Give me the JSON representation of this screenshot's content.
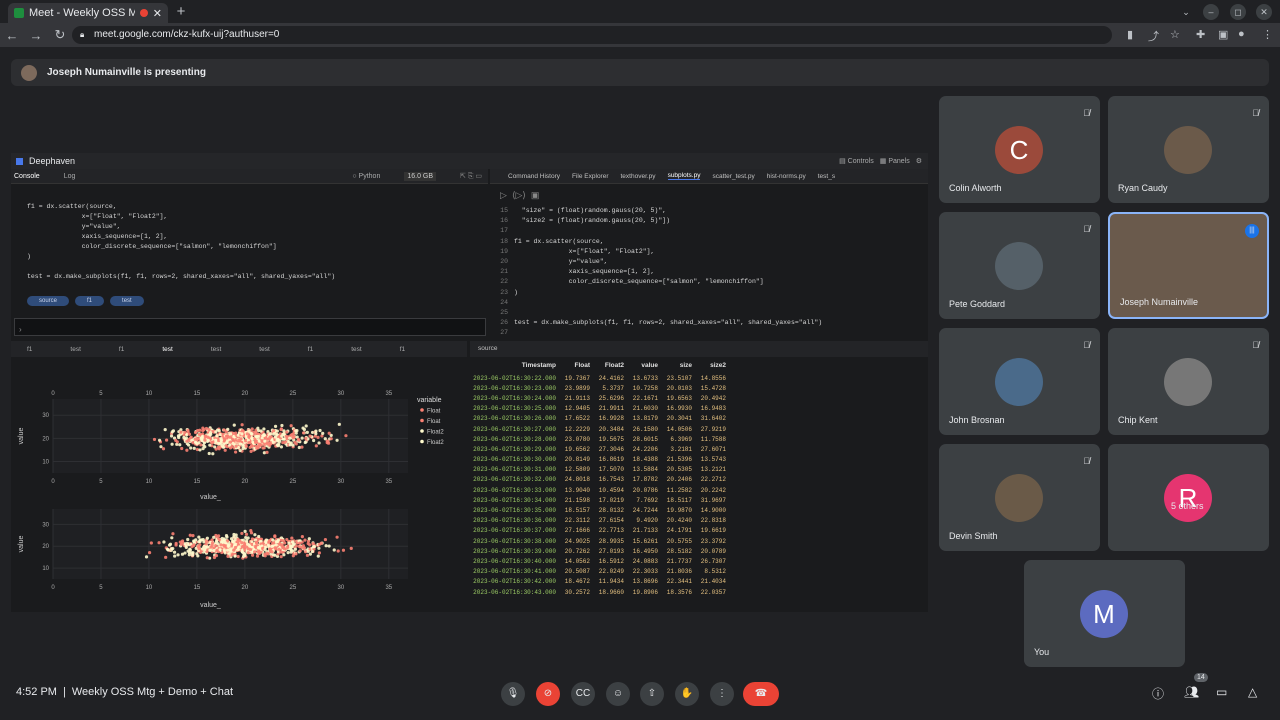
{
  "browser": {
    "tab_title": "Meet - Weekly OSS Mtg",
    "url": "meet.google.com/ckz-kufx-uij?authuser=0"
  },
  "banner": {
    "text": "Joseph Numainville is presenting"
  },
  "deephaven": {
    "title": "Deephaven",
    "controls_label": "Controls",
    "panels_label": "Panels",
    "console_tab": "Console",
    "log_tab": "Log",
    "lang": "Python",
    "mem": "16.0 GB",
    "console_code": "f1 = dx.scatter(source,\n              x=[\"Float\", \"Float2\"],\n              y=\"value\",\n              xaxis_sequence=[1, 2],\n              color_discrete_sequence=[\"salmon\", \"lemonchiffon\"]\n)\n\ntest = dx.make_subplots(f1, f1, rows=2, shared_xaxes=\"all\", shared_yaxes=\"all\")",
    "console_pills": [
      "source",
      "f1",
      "test"
    ],
    "editor_tabs": [
      "Command History",
      "File Explorer",
      "texthover.py",
      "subplots.py",
      "scatter_test.py",
      "hist-norms.py",
      "test_s"
    ],
    "editor_active_tab": "subplots.py",
    "editor_lines": [
      {
        "n": "15",
        "code": "  \"size\" = (float)random.gauss(20, 5)\","
      },
      {
        "n": "16",
        "code": "  \"size2 = (float)random.gauss(20, 5)\"])"
      },
      {
        "n": "17",
        "code": ""
      },
      {
        "n": "18",
        "code": "f1 = dx.scatter(source,"
      },
      {
        "n": "19",
        "code": "              x=[\"Float\", \"Float2\"],"
      },
      {
        "n": "20",
        "code": "              y=\"value\","
      },
      {
        "n": "21",
        "code": "              xaxis_sequence=[1, 2],"
      },
      {
        "n": "22",
        "code": "              color_discrete_sequence=[\"salmon\", \"lemonchiffon\"]"
      },
      {
        "n": "23",
        "code": ")"
      },
      {
        "n": "24",
        "code": ""
      },
      {
        "n": "25",
        "code": ""
      },
      {
        "n": "26",
        "code": "test = dx.make_subplots(f1, f1, rows=2, shared_xaxes=\"all\", shared_yaxes=\"all\")"
      },
      {
        "n": "27",
        "code": ""
      }
    ],
    "plot_tabs": [
      "f1",
      "test",
      "f1",
      "test",
      "test",
      "test",
      "f1",
      "test",
      "f1"
    ],
    "plot_active": "test",
    "table_tab": "source",
    "table_columns": [
      "Timestamp",
      "Float",
      "Float2",
      "value",
      "size",
      "size2"
    ],
    "table_rows": [
      [
        "2023-06-02T16:30:22.000",
        "19.7367",
        "24.4162",
        "13.6733",
        "23.5107",
        "14.8556"
      ],
      [
        "2023-06-02T16:30:23.000",
        "23.9899",
        "5.3737",
        "10.7258",
        "20.0103",
        "15.4728"
      ],
      [
        "2023-06-02T16:30:24.000",
        "21.9113",
        "25.6296",
        "22.1671",
        "19.6563",
        "20.4942"
      ],
      [
        "2023-06-02T16:30:25.000",
        "12.9405",
        "21.9911",
        "21.6030",
        "16.9930",
        "16.9483"
      ],
      [
        "2023-06-02T16:30:26.000",
        "17.6522",
        "16.9928",
        "13.8179",
        "20.3041",
        "31.6402"
      ],
      [
        "2023-06-02T16:30:27.000",
        "12.2229",
        "20.3484",
        "26.1580",
        "14.0506",
        "27.9219"
      ],
      [
        "2023-06-02T16:30:28.000",
        "23.0780",
        "19.5675",
        "28.6015",
        "6.3969",
        "11.7588"
      ],
      [
        "2023-06-02T16:30:29.000",
        "19.6562",
        "27.3046",
        "24.2206",
        "3.2181",
        "27.6071"
      ],
      [
        "2023-06-02T16:30:30.000",
        "20.8149",
        "16.8619",
        "18.4388",
        "21.5396",
        "13.5743"
      ],
      [
        "2023-06-02T16:30:31.000",
        "12.5809",
        "17.5070",
        "13.5884",
        "20.5305",
        "13.2121"
      ],
      [
        "2023-06-02T16:30:32.000",
        "24.8018",
        "16.7543",
        "17.8782",
        "20.2406",
        "22.2712"
      ],
      [
        "2023-06-02T16:30:33.000",
        "13.9040",
        "10.4594",
        "20.0786",
        "11.2582",
        "20.2242"
      ],
      [
        "2023-06-02T16:30:34.000",
        "21.1598",
        "17.0219",
        "7.7692",
        "18.5117",
        "31.9697"
      ],
      [
        "2023-06-02T16:30:35.000",
        "18.5157",
        "28.0132",
        "24.7244",
        "19.9870",
        "14.9000"
      ],
      [
        "2023-06-02T16:30:36.000",
        "22.3112",
        "27.6154",
        "9.4920",
        "20.4240",
        "22.8318"
      ],
      [
        "2023-06-02T16:30:37.000",
        "27.1666",
        "22.7713",
        "21.7133",
        "24.1791",
        "19.6619"
      ],
      [
        "2023-06-02T16:30:38.000",
        "24.9025",
        "28.9935",
        "15.6261",
        "20.5755",
        "23.3792"
      ],
      [
        "2023-06-02T16:30:39.000",
        "20.7262",
        "27.0193",
        "16.4950",
        "28.5182",
        "20.0789"
      ],
      [
        "2023-06-02T16:30:40.000",
        "14.0562",
        "16.5912",
        "24.0883",
        "21.7737",
        "26.7307"
      ],
      [
        "2023-06-02T16:30:41.000",
        "20.5087",
        "22.0249",
        "22.3033",
        "21.8036",
        "8.5312"
      ],
      [
        "2023-06-02T16:30:42.000",
        "18.4672",
        "11.9434",
        "13.8696",
        "22.3441",
        "21.4034"
      ],
      [
        "2023-06-02T16:30:43.000",
        "30.2572",
        "18.9660",
        "19.8906",
        "18.3576",
        "22.0357"
      ]
    ]
  },
  "chart_data": [
    {
      "type": "scatter",
      "xlabel": "value_",
      "ylabel": "value",
      "xlim": [
        0,
        37
      ],
      "ylim": [
        5,
        37
      ],
      "x_ticks": [
        0,
        5,
        10,
        15,
        20,
        25,
        30,
        35
      ],
      "y_ticks": [
        10,
        20,
        30
      ],
      "legend_title": "variable",
      "legend_entries": [
        "Float",
        "Float",
        "Float2",
        "Float2"
      ],
      "legend_placement": "right",
      "colors": [
        "#fa8072",
        "#fffacd"
      ],
      "series_color_names": [
        "salmon",
        "lemonchiffon"
      ]
    },
    {
      "type": "scatter",
      "xlabel": "value_",
      "ylabel": "value",
      "xlim": [
        0,
        37
      ],
      "ylim": [
        5,
        37
      ],
      "x_ticks": [
        0,
        5,
        10,
        15,
        20,
        25,
        30,
        35
      ],
      "y_ticks": [
        10,
        20,
        30
      ]
    }
  ],
  "participants": [
    {
      "name": "Colin Alworth",
      "initial": "C",
      "muted": true
    },
    {
      "name": "Ryan Caudy",
      "initial": "",
      "muted": true
    },
    {
      "name": "Pete Goddard",
      "initial": "",
      "muted": true
    },
    {
      "name": "Joseph Numainville",
      "initial": "",
      "muted": false
    },
    {
      "name": "John Brosnan",
      "initial": "",
      "muted": true
    },
    {
      "name": "Chip Kent",
      "initial": "",
      "muted": true
    },
    {
      "name": "Devin Smith",
      "initial": "",
      "muted": true
    },
    {
      "name": "5 others",
      "initial": "R",
      "muted": false
    },
    {
      "name": "You",
      "initial": "M",
      "muted": false
    }
  ],
  "meeting": {
    "time": "4:52 PM",
    "separator": "|",
    "title": "Weekly OSS Mtg + Demo + Chat",
    "people_count": "14"
  },
  "colors": {
    "leave": "#ea4335",
    "accent": "#8ab4f8",
    "avatar_c": "#9b4a3b",
    "avatar_m": "#5c6bc0",
    "avatar_r": "#e53570"
  }
}
